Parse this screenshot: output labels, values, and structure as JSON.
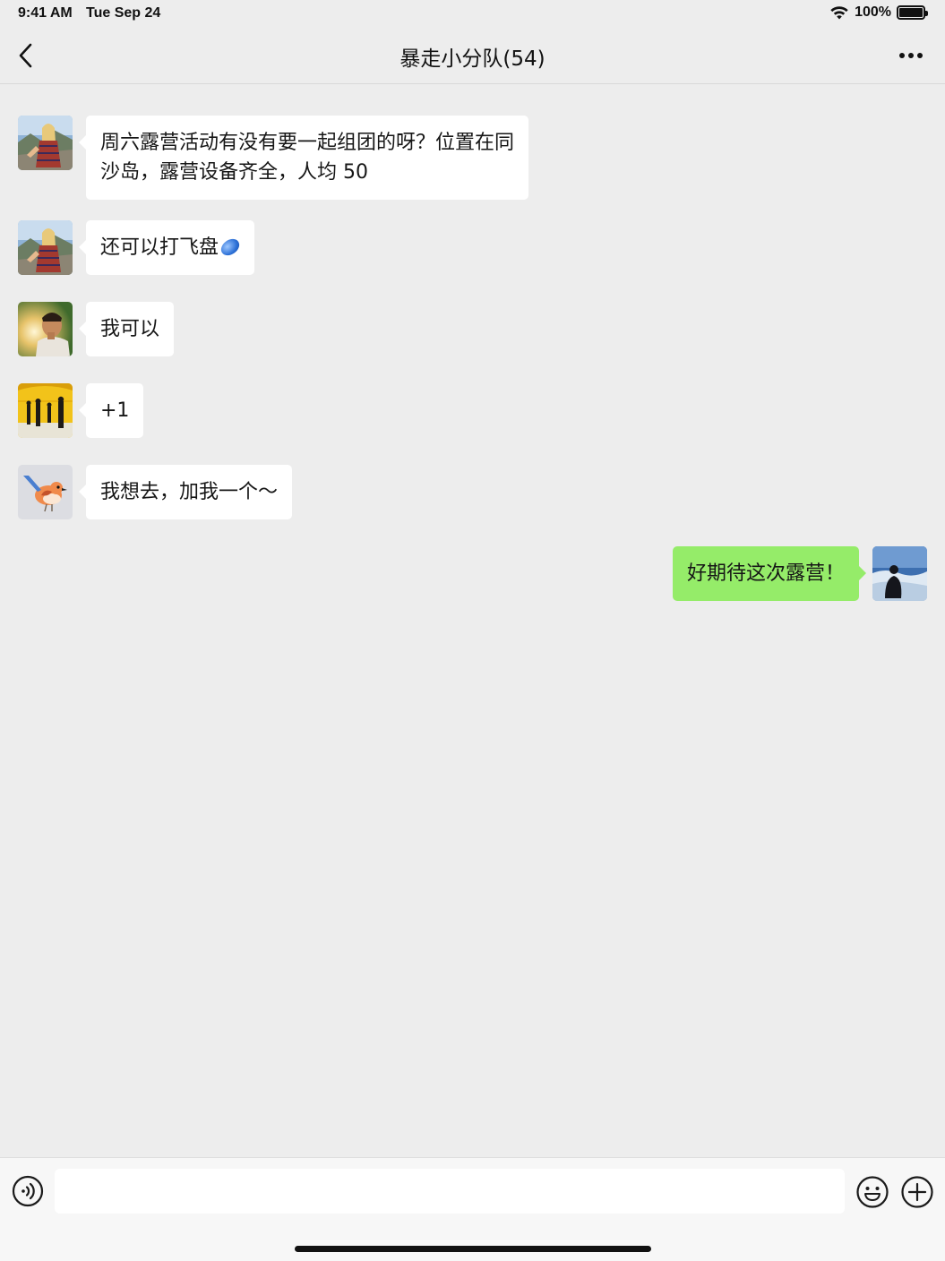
{
  "status": {
    "time": "9:41 AM",
    "date": "Tue Sep 24",
    "battery": "100%",
    "battery_level": 1.0
  },
  "nav": {
    "title": "暴走小分队(54)",
    "back_icon": "chevron-left-icon",
    "more_icon": "ellipsis-icon"
  },
  "messages": [
    {
      "side": "left",
      "avatar": "woman-hiking-photo",
      "text_line1": "周六露营活动有没有要一起组团的呀？位置在同",
      "text_line2": "沙岛，露营设备齐全，人均 50"
    },
    {
      "side": "left",
      "avatar": "woman-hiking-photo",
      "text": "还可以打飞盘",
      "emoji": "frisbee-emoji"
    },
    {
      "side": "left",
      "avatar": "man-sunlight-photo",
      "text": "我可以"
    },
    {
      "side": "left",
      "avatar": "yellow-tunnel-photo",
      "text": "+1"
    },
    {
      "side": "left",
      "avatar": "bird-illustration",
      "text": "我想去，加我一个～"
    },
    {
      "side": "right",
      "avatar": "person-seaside-photo",
      "text": "好期待这次露营！"
    }
  ],
  "input": {
    "value": "",
    "placeholder": "",
    "voice_icon": "voice-icon",
    "emoji_icon": "emoji-icon",
    "plus_icon": "plus-circle-icon"
  },
  "colors": {
    "background": "#ededed",
    "bubble_left": "#ffffff",
    "bubble_right": "#95ec69",
    "input_bar": "#f7f7f7"
  }
}
